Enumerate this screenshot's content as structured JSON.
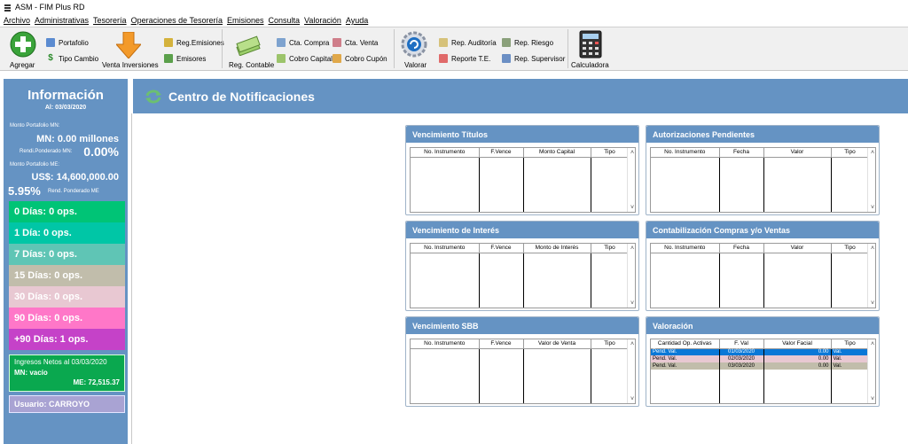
{
  "window": {
    "title": "ASM - FIM Plus RD"
  },
  "menu": [
    "Archivo",
    "Administrativas",
    "Tesorería",
    "Operaciones de Tesorería",
    "Emisiones",
    "Consulta",
    "Valoración",
    "Ayuda"
  ],
  "toolbar": {
    "agregar": "Agregar",
    "portafolio": "Portafolio",
    "tipo_cambio": "Tipo Cambio",
    "venta_inversiones": "Venta Inversiones",
    "reg_emisiones": "Reg.Emisiones",
    "emisores": "Emisores",
    "reg_contable": "Reg. Contable",
    "cta_compra": "Cta. Compra",
    "cobro_capital": "Cobro Capital",
    "cta_venta": "Cta. Venta",
    "cobro_cupon": "Cobro Cupón",
    "valorar": "Valorar",
    "rep_auditoria": "Rep. Auditoría",
    "reporte_te": "Reporte T.E.",
    "rep_riesgo": "Rep. Riesgo",
    "rep_supervisor": "Rep. Supervisor",
    "calculadora": "Calculadora"
  },
  "sidebar": {
    "title": "Información",
    "date": "Al: 03/03/2020",
    "monto_mn_label": "Monto Portafolio MN:",
    "monto_mn_value": "MN: 0.00 millones",
    "rend_mn_label": "Rendi.Ponderado MN:",
    "rend_mn_value": "0.00%",
    "monto_me_label": "Monto Portafolio ME:",
    "monto_me_value": "US$: 14,600,000.00",
    "rend_me_value": "5.95%",
    "rend_me_label": "Rend. Ponderado ME",
    "days": [
      {
        "label": "0 Días: 0 ops.",
        "color": "#00c476"
      },
      {
        "label": "1 Día: 0 ops.",
        "color": "#00c6a6"
      },
      {
        "label": "7 Días: 0 ops.",
        "color": "#5fc5b5"
      },
      {
        "label": "15 Días: 0 ops.",
        "color": "#c1bdab"
      },
      {
        "label": "30 Días: 0 ops.",
        "color": "#e8c8d2"
      },
      {
        "label": "90 Días: 0 ops.",
        "color": "#ff77c8"
      },
      {
        "label": "+90 Días: 1 ops.",
        "color": "#c542c8"
      }
    ],
    "ingresos_title": "Ingresos Netos al 03/03/2020",
    "ingresos_mn": "MN: vacío",
    "ingresos_me": "ME: 72,515.37",
    "usuario": "Usuario: CARROYO"
  },
  "header": {
    "title": "Centro de Notificaciones"
  },
  "panels": {
    "vencimiento_titulos": {
      "title": "Vencimiento Títulos",
      "cols": [
        "No. Instrumento",
        "F.Vence",
        "Monto Capital",
        "Tipo"
      ]
    },
    "autorizaciones": {
      "title": "Autorizaciones Pendientes",
      "cols": [
        "No. Instrumento",
        "Fecha",
        "Valor",
        "Tipo"
      ]
    },
    "vencimiento_interes": {
      "title": "Vencimiento de Interés",
      "cols": [
        "No. Instrumento",
        "F.Vence",
        "Monto de Interés",
        "Tipo"
      ]
    },
    "contabilizacion": {
      "title": "Contabilización Compras y/o Ventas",
      "cols": [
        "No. Instrumento",
        "Fecha",
        "Valor",
        "Tipo"
      ]
    },
    "vencimiento_sbb": {
      "title": "Vencimiento SBB",
      "cols": [
        "No. Instrumento",
        "F.Vence",
        "Valor de Venta",
        "Tipo"
      ]
    },
    "valoracion": {
      "title": "Valoración",
      "cols": [
        "Cantidad Op. Activas",
        "F. Val",
        "Valor Facial",
        "Tipo"
      ],
      "rows": [
        {
          "c0": "Pend. Val.",
          "c1": "01/03/2020",
          "c2": "0.00",
          "c3": "Val.",
          "bg": "#0a78d7",
          "fg": "#ffffff"
        },
        {
          "c0": "Pend. Val.",
          "c1": "02/03/2020",
          "c2": "0.00",
          "c3": "Val.",
          "bg": "#e8c8d2",
          "fg": "#000000"
        },
        {
          "c0": "Pend. Val.",
          "c1": "03/03/2020",
          "c2": "0.00",
          "c3": "Val.",
          "bg": "#c1bdab",
          "fg": "#000000"
        }
      ]
    }
  }
}
